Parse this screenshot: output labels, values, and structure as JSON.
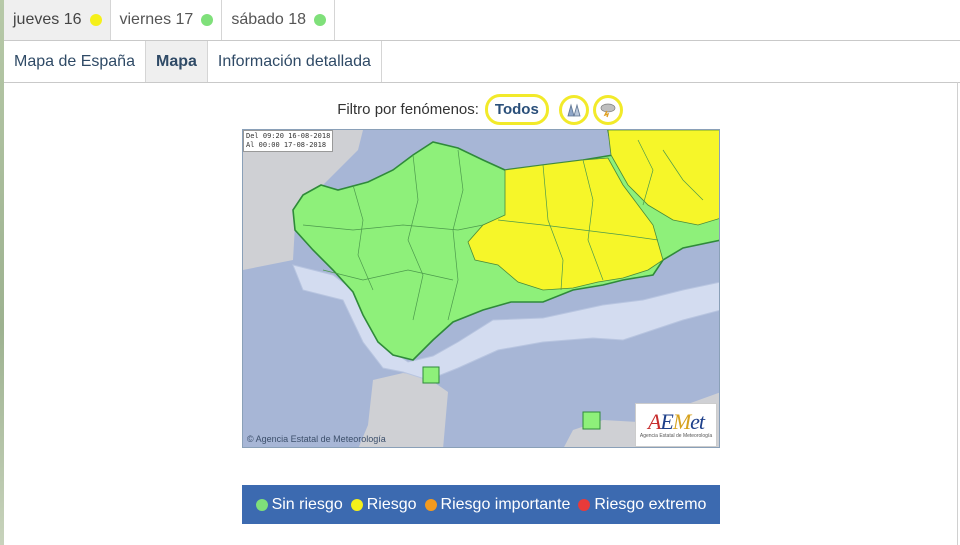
{
  "day_tabs": [
    {
      "label": "jueves 16",
      "status_color": "#f5f01a",
      "active": true
    },
    {
      "label": "viernes 17",
      "status_color": "#7fe07a",
      "active": false
    },
    {
      "label": "sábado 18",
      "status_color": "#7fe07a",
      "active": false
    }
  ],
  "sub_tabs": [
    {
      "label": "Mapa de España",
      "active": false
    },
    {
      "label": "Mapa",
      "active": true
    },
    {
      "label": "Información detallada",
      "active": false
    }
  ],
  "filter": {
    "label": "Filtro por fenómenos:",
    "todos_label": "Todos",
    "icons": [
      "heat-thermometer-icon",
      "storm-cloud-icon"
    ],
    "highlight_color": "#f2ea2a"
  },
  "map": {
    "time_line1": "Del 09:20 16-08-2018",
    "time_line2": "Al  00:00 17-08-2018",
    "credit": "© Agencia Estatal de Meteorología",
    "logo_subtitle": "Agencia Estatal de Meteorología",
    "colors": {
      "no_risk": "#8ef07a",
      "risk": "#f6f629",
      "sea": "#a7b6d6",
      "coast_band": "#d3dcf0",
      "other_land": "#cfd0d4"
    }
  },
  "legend": {
    "items": [
      {
        "label": "Sin riesgo",
        "color": "#7fe07a"
      },
      {
        "label": "Riesgo",
        "color": "#f5f01a"
      },
      {
        "label": "Riesgo importante",
        "color": "#f39a1e"
      },
      {
        "label": "Riesgo extremo",
        "color": "#e83a3a"
      }
    ],
    "background": "#3c6ab0"
  }
}
